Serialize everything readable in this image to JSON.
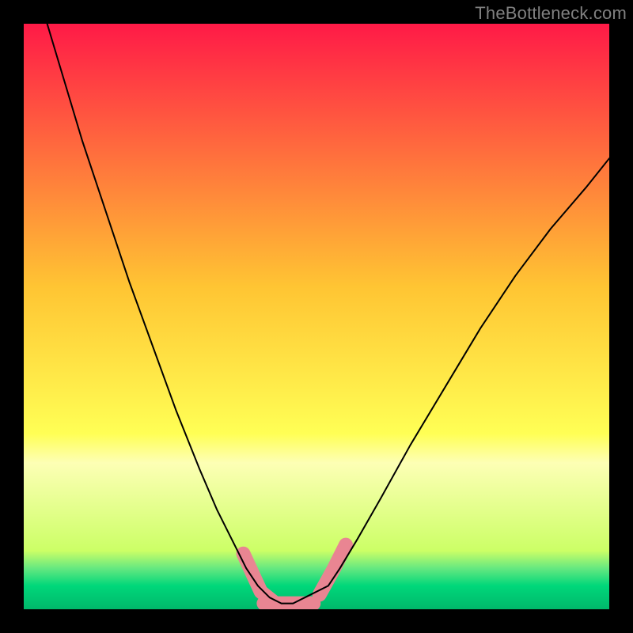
{
  "watermark": "TheBottleneck.com",
  "chart_data": {
    "type": "line",
    "title": "",
    "xlabel": "",
    "ylabel": "",
    "xlim": [
      0,
      100
    ],
    "ylim": [
      0,
      100
    ],
    "grid": false,
    "axes_visible": false,
    "background": {
      "type": "vertical_gradient",
      "stops": [
        {
          "offset": 0.0,
          "color": "#ff1a47"
        },
        {
          "offset": 0.45,
          "color": "#ffc533"
        },
        {
          "offset": 0.7,
          "color": "#ffff55"
        },
        {
          "offset": 0.75,
          "color": "#fdffb5"
        },
        {
          "offset": 0.9,
          "color": "#ccff66"
        },
        {
          "offset": 0.93,
          "color": "#66e880"
        },
        {
          "offset": 0.96,
          "color": "#00d77a"
        },
        {
          "offset": 1.0,
          "color": "#00b86b"
        }
      ]
    },
    "series": [
      {
        "name": "bottleneck-curve",
        "stroke": "#000000",
        "stroke_width": 2,
        "x": [
          4,
          7,
          10,
          14,
          18,
          22,
          26,
          30,
          33,
          36,
          38,
          40,
          42,
          44,
          46,
          48,
          52,
          54,
          57,
          61,
          66,
          72,
          78,
          84,
          90,
          96,
          100
        ],
        "y": [
          100,
          90,
          80,
          68,
          56,
          45,
          34,
          24,
          17,
          11,
          7,
          4,
          2,
          1,
          1,
          2,
          4,
          7,
          12,
          19,
          28,
          38,
          48,
          57,
          65,
          72,
          77
        ]
      }
    ],
    "highlight_segments": [
      {
        "name": "pink-left-leg",
        "stroke": "#e98592",
        "stroke_width": 18,
        "linecap": "round",
        "x": [
          37.5,
          40.5,
          43.0
        ],
        "y": [
          9.5,
          3.0,
          1.0
        ]
      },
      {
        "name": "pink-bottom-flat",
        "stroke": "#e98592",
        "stroke_width": 18,
        "linecap": "round",
        "x": [
          41.0,
          49.5
        ],
        "y": [
          1.0,
          1.0
        ]
      },
      {
        "name": "pink-right-leg",
        "stroke": "#e98592",
        "stroke_width": 18,
        "linecap": "round",
        "x": [
          50.5,
          53.0,
          55.0
        ],
        "y": [
          2.5,
          7.0,
          11.0
        ]
      }
    ]
  }
}
